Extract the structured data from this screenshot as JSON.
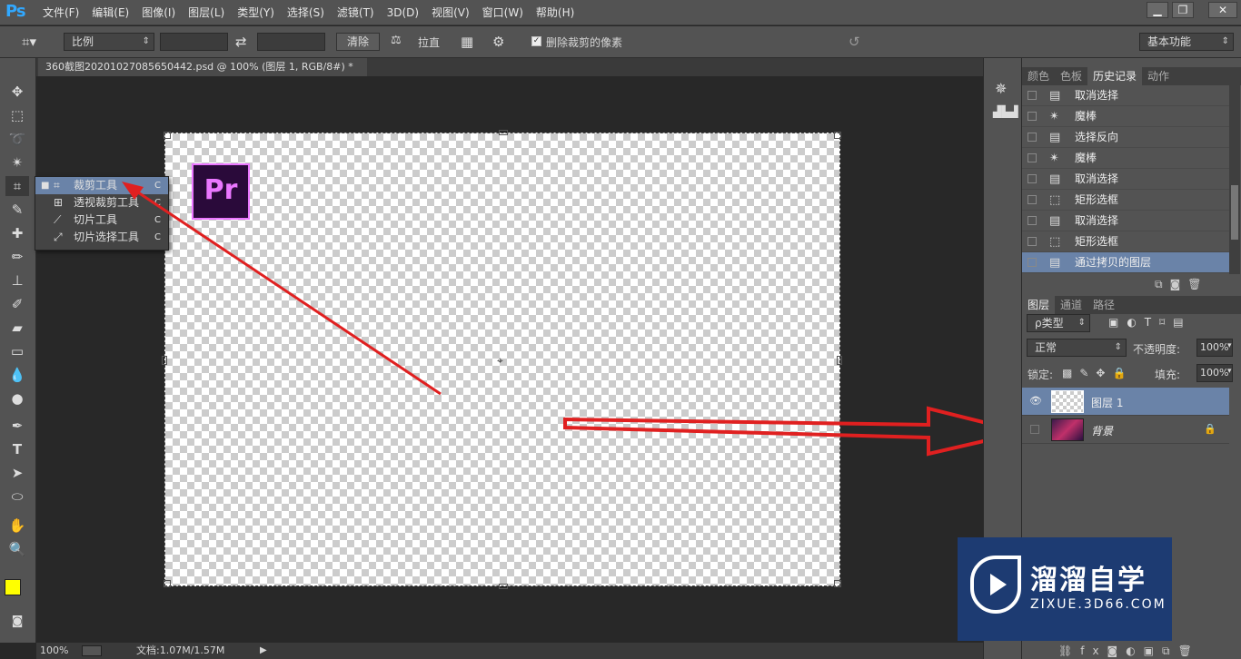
{
  "app": {
    "logo": "Ps",
    "menus": [
      "文件(F)",
      "编辑(E)",
      "图像(I)",
      "图层(L)",
      "类型(Y)",
      "选择(S)",
      "滤镜(T)",
      "3D(D)",
      "视图(V)",
      "窗口(W)",
      "帮助(H)"
    ],
    "win": [
      "▁",
      "❐",
      "✕"
    ]
  },
  "options": {
    "ratio": "比例",
    "clear": "清除",
    "straighten": "拉直",
    "delete_crop_label": "删除裁剪的像素",
    "workspace": "基本功能"
  },
  "document": {
    "tab_title": "360截图20201027085650442.psd @ 100% (图层 1, RGB/8#) *",
    "tab_close": "×"
  },
  "flyout": {
    "items": [
      {
        "label": "裁剪工具",
        "key": "C",
        "icon": "crop-icon"
      },
      {
        "label": "透视裁剪工具",
        "key": "C",
        "icon": "perspective-crop-icon"
      },
      {
        "label": "切片工具",
        "key": "C",
        "icon": "slice-icon"
      },
      {
        "label": "切片选择工具",
        "key": "C",
        "icon": "slice-select-icon"
      }
    ]
  },
  "canvas": {
    "pr_logo": "Pr"
  },
  "status": {
    "zoom": "100%",
    "doc": "文档:1.07M/1.57M"
  },
  "history": {
    "tabs": [
      "颜色",
      "色板",
      "历史记录",
      "动作"
    ],
    "items": [
      "取消选择",
      "魔棒",
      "选择反向",
      "魔棒",
      "取消选择",
      "矩形选框",
      "取消选择",
      "矩形选框",
      "通过拷贝的图层"
    ]
  },
  "layers": {
    "tabs": [
      "图层",
      "通道",
      "路径"
    ],
    "filter": "ρ类型",
    "blend": "正常",
    "opacity_label": "不透明度:",
    "opacity": "100%",
    "lock_label": "锁定:",
    "fill_label": "填充:",
    "fill": "100%",
    "items": [
      {
        "name": "图层 1"
      },
      {
        "name": "背景"
      }
    ]
  },
  "watermark": {
    "title": "溜溜自学",
    "url": "ZIXUE.3D66.COM"
  },
  "colors": {
    "fg": "#ffff00",
    "bg": "#33cc33",
    "accent": "#6a83a8"
  }
}
